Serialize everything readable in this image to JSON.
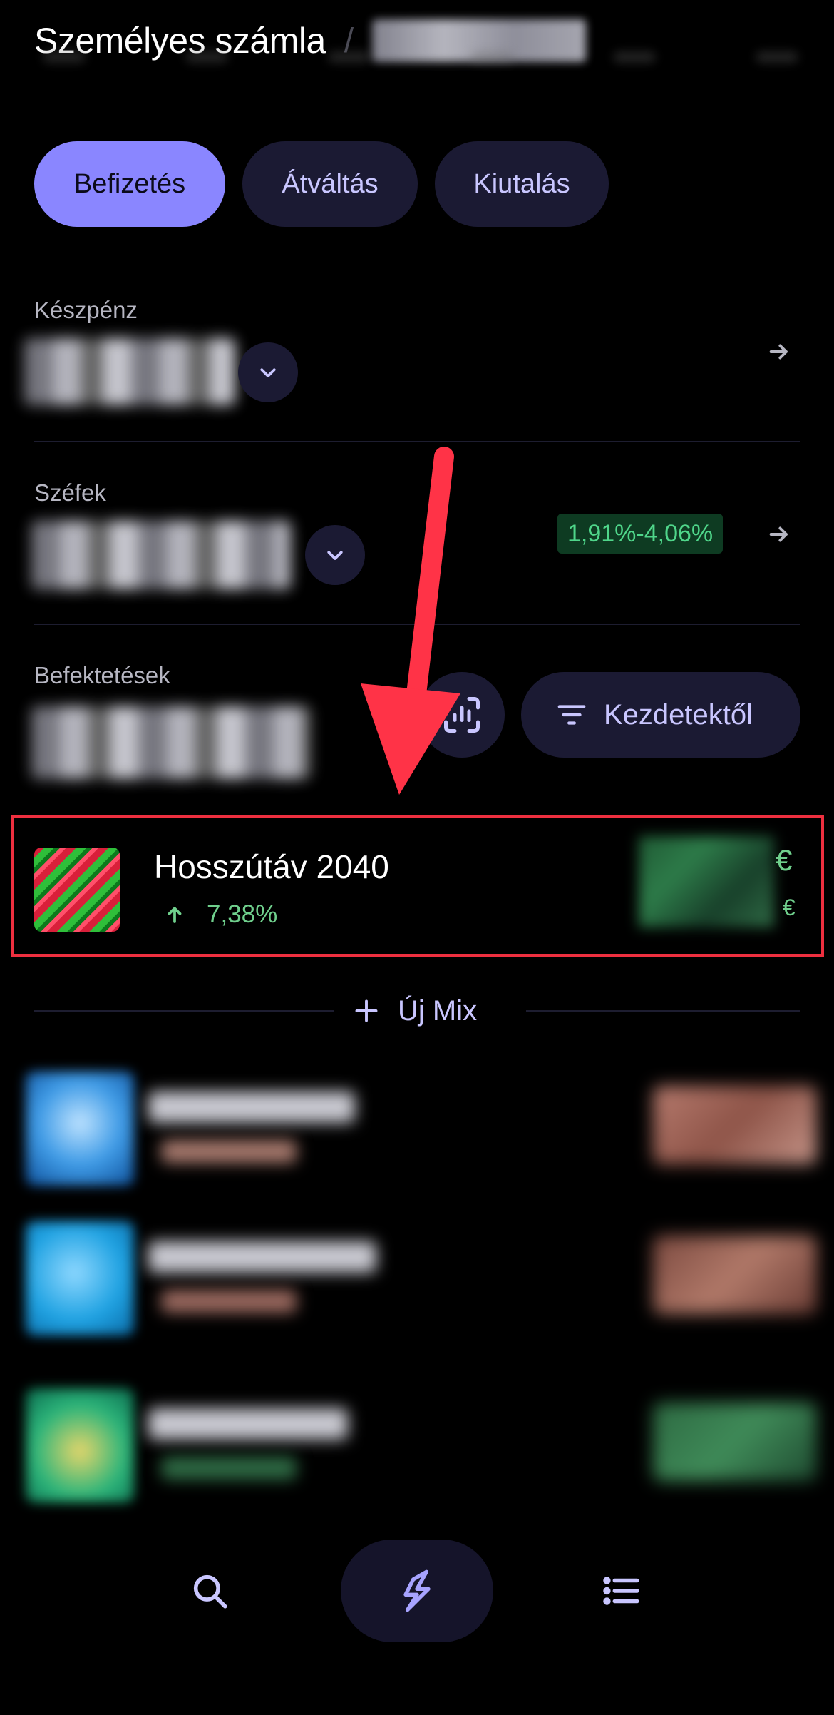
{
  "header": {
    "title": "Személyes számla",
    "separator": "/"
  },
  "actions": {
    "deposit": "Befizetés",
    "exchange": "Átváltás",
    "withdraw": "Kiutalás"
  },
  "cash": {
    "label": "Készpénz"
  },
  "vaults": {
    "label": "Széfek",
    "rate_range": "1,91%-4,06%"
  },
  "investments": {
    "label": "Befektetések",
    "filter_label": "Kezdetektől"
  },
  "mix": {
    "name": "Hosszútáv 2040",
    "change": "7,38%",
    "currency": "€",
    "currency_small": "€"
  },
  "new_mix": {
    "label": "Új Mix"
  },
  "icons": {
    "chevron": "chevron-down-icon",
    "arrow": "arrow-right-icon",
    "chart": "chart-scan-icon",
    "filter": "filter-lines-icon",
    "trend": "arrow-up-icon",
    "plus": "plus-icon",
    "search": "search-icon",
    "bolt": "lightning-icon",
    "list": "list-icon"
  },
  "colors": {
    "accent": "#8a86ff",
    "positive": "#6fcf8c",
    "highlight": "#ee2f3f",
    "pill_bg": "#1b1a33"
  }
}
